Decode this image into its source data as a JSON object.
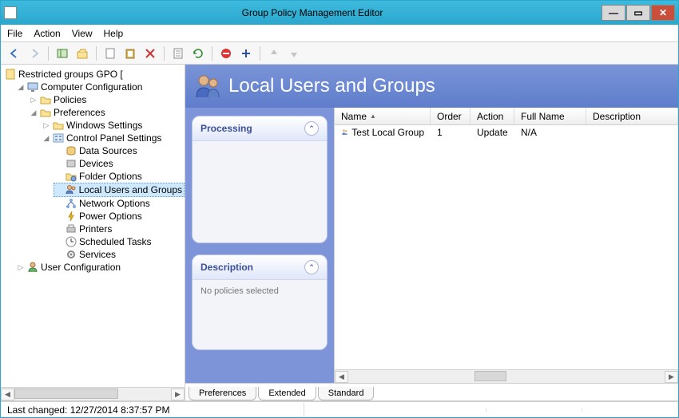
{
  "window": {
    "title": "Group Policy Management Editor"
  },
  "menu": {
    "file": "File",
    "action": "Action",
    "view": "View",
    "help": "Help"
  },
  "tree": {
    "root": "Restricted groups GPO [",
    "computerConfig": "Computer Configuration",
    "policies": "Policies",
    "preferences": "Preferences",
    "windowsSettings": "Windows Settings",
    "controlPanel": "Control Panel Settings",
    "dataSources": "Data Sources",
    "devices": "Devices",
    "folderOptions": "Folder Options",
    "localUsersGroups": "Local Users and Groups",
    "networkOptions": "Network Options",
    "powerOptions": "Power Options",
    "printers": "Printers",
    "scheduledTasks": "Scheduled Tasks",
    "services": "Services",
    "userConfig": "User Configuration"
  },
  "banner": {
    "title": "Local Users and Groups"
  },
  "cards": {
    "processing": {
      "title": "Processing"
    },
    "description": {
      "title": "Description",
      "body": "No policies selected"
    }
  },
  "columns": {
    "name": "Name",
    "order": "Order",
    "action": "Action",
    "fullname": "Full Name",
    "description": "Description"
  },
  "rows": [
    {
      "name": "Test Local Group",
      "order": "1",
      "action": "Update",
      "fullname": "N/A",
      "description": ""
    }
  ],
  "tabs": {
    "preferences": "Preferences",
    "extended": "Extended",
    "standard": "Standard"
  },
  "status": {
    "lastChanged": "Last changed: 12/27/2014 8:37:57 PM"
  }
}
